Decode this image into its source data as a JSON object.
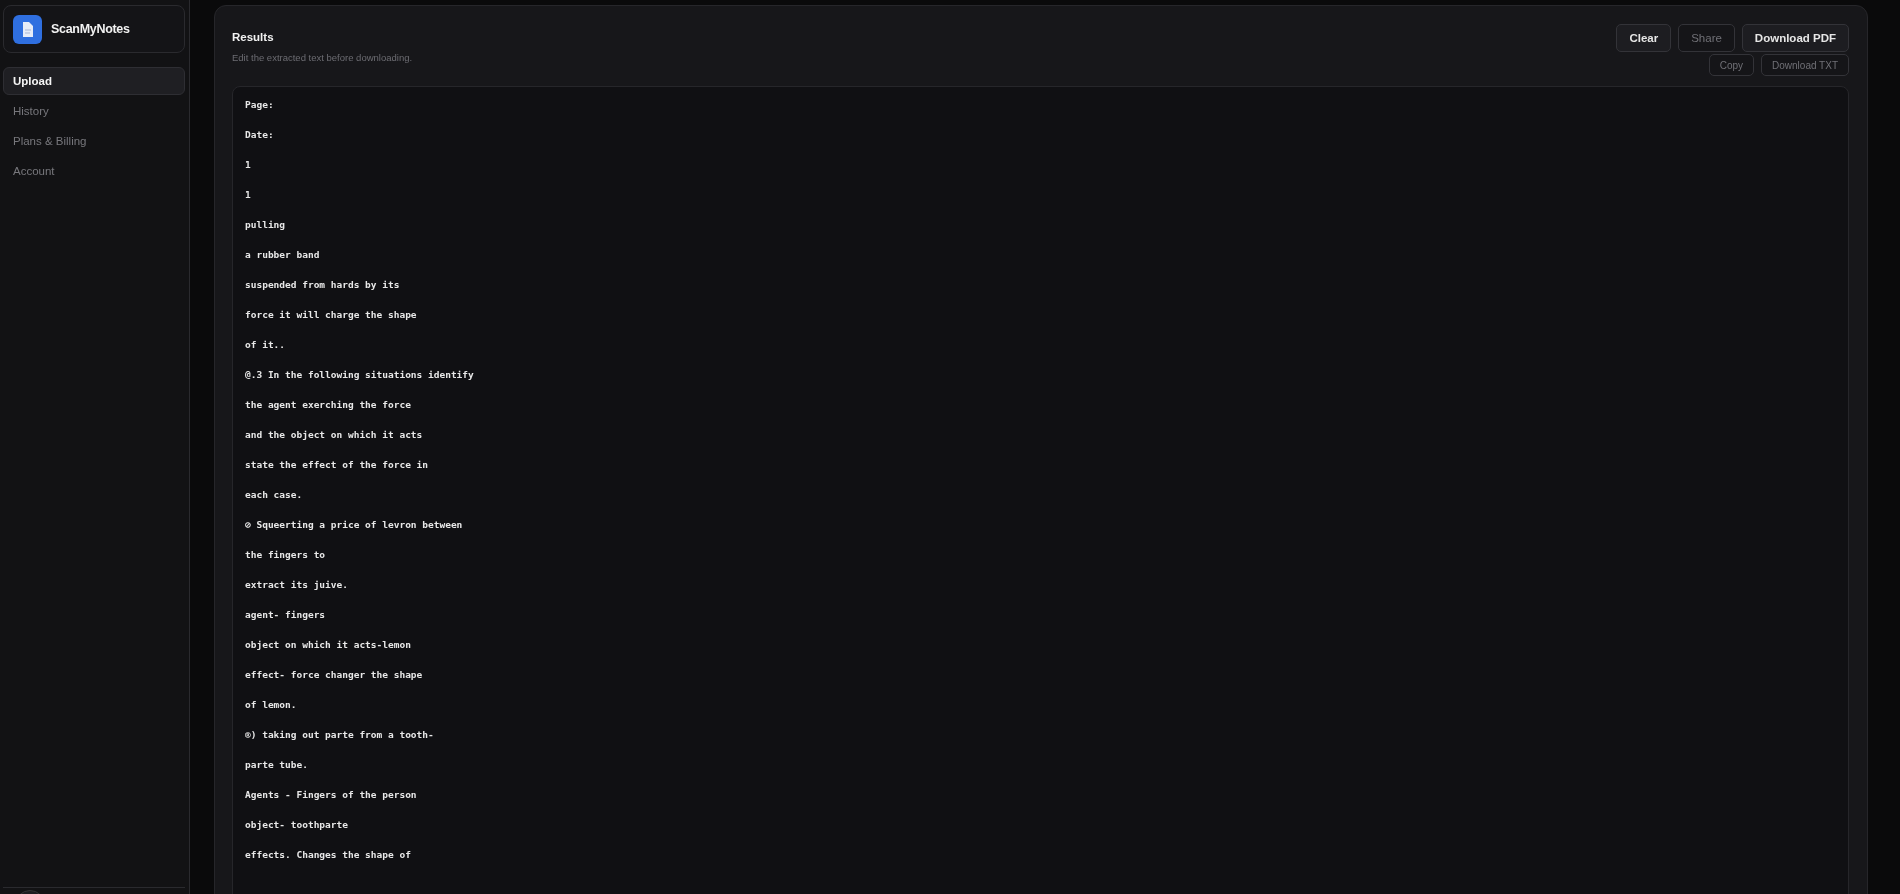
{
  "sidebar": {
    "brand": "ScanMyNotes",
    "items": [
      {
        "label": "Upload",
        "selected": true
      },
      {
        "label": "History",
        "selected": false
      },
      {
        "label": "Plans & Billing",
        "selected": false
      },
      {
        "label": "Account",
        "selected": false
      }
    ]
  },
  "results": {
    "title": "Results",
    "subtitle": "Edit the extracted text before downloading.",
    "buttons": [
      [
        {
          "label": "Clear",
          "disabled": false
        },
        {
          "label": "Share",
          "disabled": true
        },
        {
          "label": "Download PDF",
          "disabled": false
        }
      ],
      [
        {
          "label": "Copy",
          "disabled": true
        },
        {
          "label": "Download TXT",
          "disabled": true
        }
      ]
    ],
    "lines": [
      "Page:",
      "Date:",
      "1",
      "1",
      "pulling",
      "a rubber band",
      "suspended from hards by its",
      "force it will charge the shape",
      "of it..",
      "@.3 In the following situations identify",
      "the agent exerching the force",
      "and the object on which it acts",
      "state the effect of the force in",
      "each case.",
      "⊘ Squeerting a price of levron between",
      "the fingers to",
      "extract its juive.",
      "agent- fingers",
      "object on which it acts-lemon",
      "effect- force changer the shape",
      "of lemon.",
      "®) taking out parte from a tooth-",
      "parte tube.",
      "Agents - Fingers of the person",
      "object- toothparte",
      "effects. Changes the shape of"
    ]
  }
}
